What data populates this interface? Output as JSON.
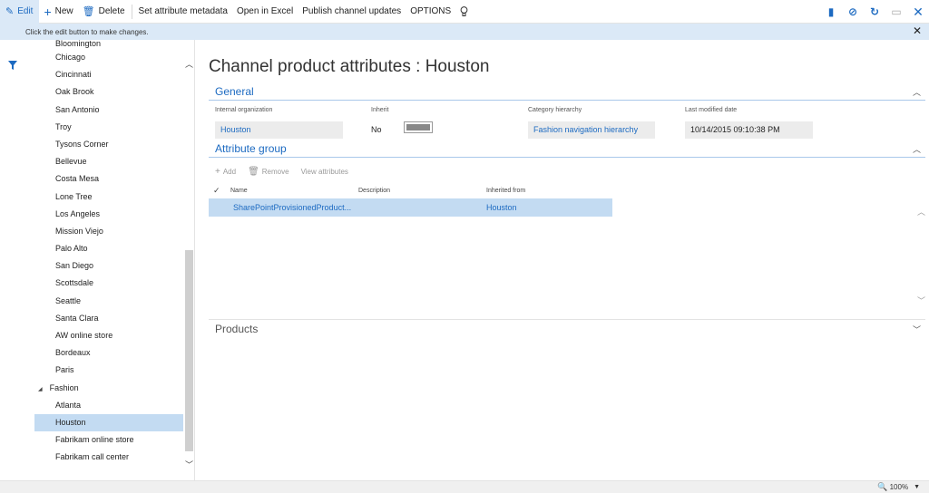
{
  "toolbar": {
    "edit": "Edit",
    "new": "New",
    "delete": "Delete",
    "set_attribute_metadata": "Set attribute metadata",
    "open_in_excel": "Open in Excel",
    "publish_channel_updates": "Publish channel updates",
    "options": "OPTIONS",
    "icons": [
      "pencil-icon",
      "plus-icon",
      "trash-icon",
      "lightbulb-icon",
      "office-icon",
      "paperclip-icon",
      "refresh-icon",
      "restore-window-icon",
      "close-icon"
    ]
  },
  "message_bar": {
    "text": "Click the edit button to make changes."
  },
  "channel_list": {
    "top_partial": "Bloomington",
    "items": [
      "Chicago",
      "Cincinnati",
      "Oak Brook",
      "San Antonio",
      "Troy",
      "Tysons Corner",
      "Bellevue",
      "Costa Mesa",
      "Lone Tree",
      "Los Angeles",
      "Mission Viejo",
      "Palo Alto",
      "San Diego",
      "Scottsdale",
      "Seattle",
      "Santa Clara",
      "AW online store",
      "Bordeaux",
      "Paris"
    ],
    "group": "Fashion",
    "group_items": [
      "Atlanta",
      "Houston",
      "Fabrikam online store",
      "Fabrikam call center"
    ],
    "selected": "Houston"
  },
  "page": {
    "title": "Channel product attributes : Houston"
  },
  "general": {
    "header": "General",
    "internal_org_label": "Internal organization",
    "internal_org_value": "Houston",
    "inherit_label": "Inherit",
    "inherit_value": "No",
    "category_label": "Category hierarchy",
    "category_value": "Fashion navigation hierarchy",
    "modified_label": "Last modified date",
    "modified_value": "10/14/2015 09:10:38 PM"
  },
  "attribute_group": {
    "header": "Attribute group",
    "add": "Add",
    "remove": "Remove",
    "view_attributes": "View attributes",
    "columns": [
      "Name",
      "Description",
      "Inherited from"
    ],
    "rows": [
      {
        "name": "SharePointProvisionedProduct...",
        "description": "",
        "inherited_from": "Houston"
      }
    ]
  },
  "products": {
    "header": "Products"
  },
  "status_bar": {
    "zoom": "100%"
  },
  "colors": {
    "accent": "#1c6ac1",
    "selected_bg": "#c3dbf2",
    "message_bg": "#dbe9f7"
  }
}
